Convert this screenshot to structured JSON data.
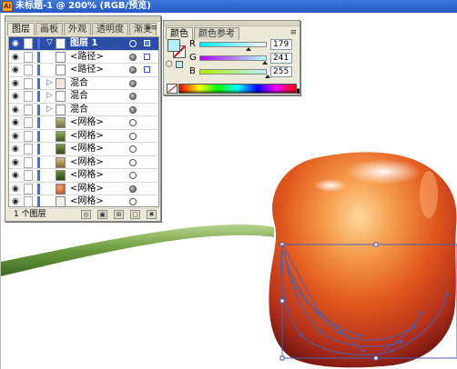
{
  "window": {
    "title": "未标题-1 @ 200% (RGB/预览)",
    "app_icon_text": "Ai"
  },
  "layers_panel": {
    "tabs": [
      {
        "label": "图层",
        "active": true
      },
      {
        "label": "画板",
        "active": false
      },
      {
        "label": "外观",
        "active": false
      },
      {
        "label": "透明度",
        "active": false
      },
      {
        "label": "渐变",
        "active": false
      }
    ],
    "menu_icon": "panel-menu-icon",
    "rows": [
      {
        "name": "图层 1",
        "kind": "layer",
        "expanded": true,
        "target_filled": false
      },
      {
        "name": "<路径>",
        "kind": "path",
        "target_filled": true
      },
      {
        "name": "<路径>",
        "kind": "path",
        "target_filled": true
      },
      {
        "name": "混合",
        "kind": "blend",
        "target_filled": true
      },
      {
        "name": "混合",
        "kind": "blend",
        "target_filled": true
      },
      {
        "name": "混合",
        "kind": "blend",
        "target_filled": true
      },
      {
        "name": "<网格>",
        "kind": "mesh",
        "target_filled": false
      },
      {
        "name": "<网格>",
        "kind": "mesh",
        "target_filled": false
      },
      {
        "name": "<网格>",
        "kind": "mesh",
        "target_filled": false
      },
      {
        "name": "<网格>",
        "kind": "mesh",
        "target_filled": false
      },
      {
        "name": "<网格>",
        "kind": "mesh",
        "target_filled": false
      },
      {
        "name": "<网格>",
        "kind": "mesh",
        "target_filled": false
      },
      {
        "name": "<网格>",
        "kind": "mesh",
        "target_filled": false
      }
    ],
    "footer": {
      "count_label": "1 个图层"
    }
  },
  "color_panel": {
    "tabs": [
      {
        "label": "颜色",
        "active": true
      },
      {
        "label": "颜色参考",
        "active": false
      }
    ],
    "fill_color": "#b3f1ff",
    "channels": [
      {
        "label": "R",
        "value": "179"
      },
      {
        "label": "G",
        "value": "241"
      },
      {
        "label": "B",
        "value": "255"
      }
    ]
  },
  "artwork": {
    "description_colors": {
      "stem": "#6a9a3c",
      "fruit_main": "#e0561c",
      "fruit_dark": "#7a1a10",
      "path_selection": "#4a5fb0"
    }
  }
}
